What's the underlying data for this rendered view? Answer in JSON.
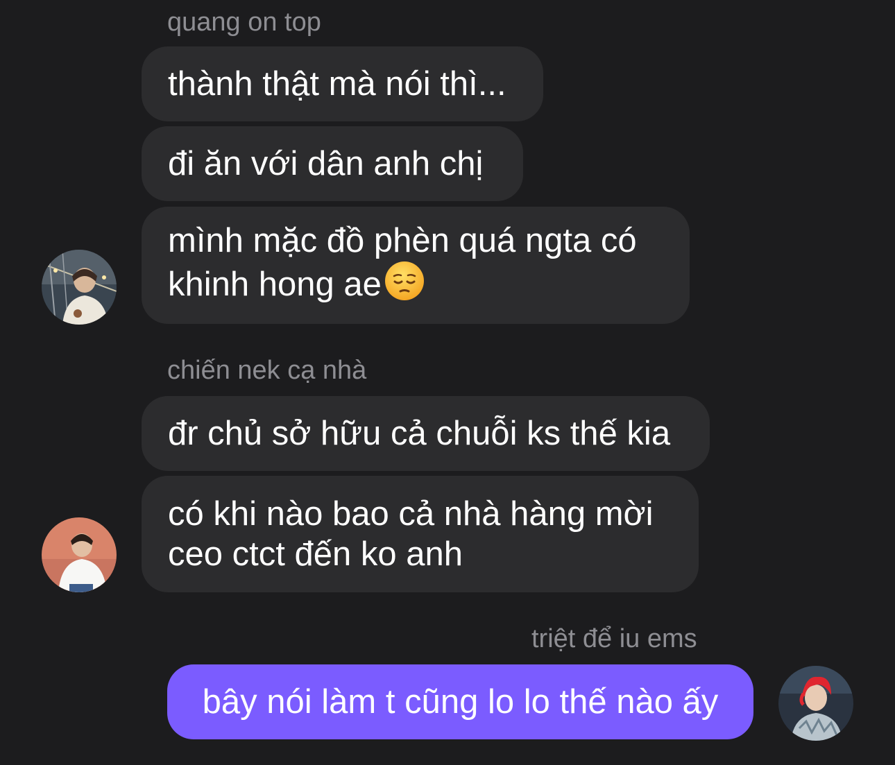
{
  "groups": [
    {
      "sender": "quang on top",
      "avatar_icon": "user-avatar-photo-night-bridge",
      "messages": [
        "thành thật mà nói thì...",
        "đi ăn với dân anh chị",
        "mình mặc đồ phèn quá ngta có\nkhinh hong ae"
      ],
      "trailing_emoji": "pensive-face-icon"
    },
    {
      "sender": "chiến nek cạ nhà",
      "avatar_icon": "user-avatar-photo-white-shirt",
      "messages": [
        "đr chủ sở hữu cả chuỗi ks thế kia",
        "có khi nào bao cả nhà hàng mời\nceo ctct đến ko anh"
      ]
    },
    {
      "sender": "triệt để iu ems",
      "avatar_icon": "user-avatar-photo-red-hair",
      "messages": [
        "bây nói làm t cũng lo lo thế nào ấy"
      ],
      "outgoing": true
    }
  ],
  "colors": {
    "background": "#1c1c1e",
    "incoming_bubble": "#2c2c2e",
    "outgoing_bubble": "#7b5cff",
    "sender_name": "#8e8e93",
    "message_text": "#ffffff"
  }
}
